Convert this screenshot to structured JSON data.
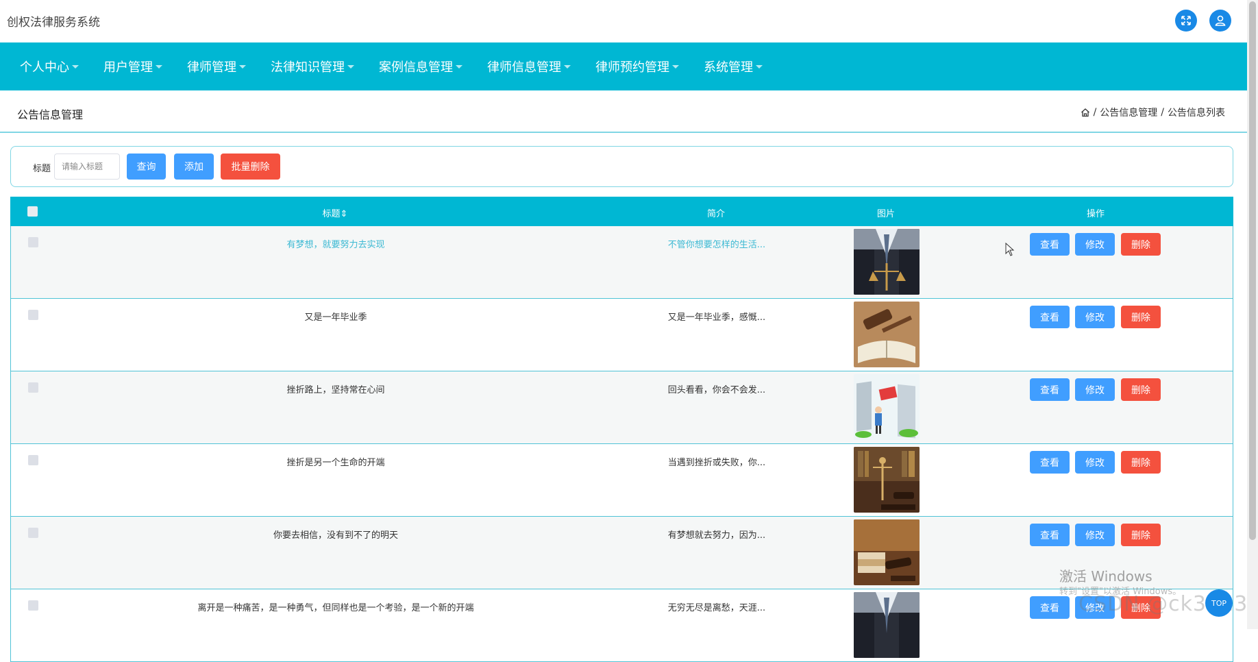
{
  "app": {
    "title": "创权法律服务系统"
  },
  "topbar": {
    "fullscreen_icon": "fullscreen-icon",
    "user_icon": "user-icon"
  },
  "nav": {
    "items": [
      {
        "label": "个人中心"
      },
      {
        "label": "用户管理"
      },
      {
        "label": "律师管理"
      },
      {
        "label": "法律知识管理"
      },
      {
        "label": "案例信息管理"
      },
      {
        "label": "律师信息管理"
      },
      {
        "label": "律师预约管理"
      },
      {
        "label": "系统管理"
      }
    ],
    "bg_color": "#00b7d3"
  },
  "page": {
    "title": "公告信息管理",
    "breadcrumb": [
      "公告信息管理",
      "公告信息列表"
    ],
    "breadcrumb_sep": "/"
  },
  "search": {
    "label": "标题",
    "placeholder": "请输入标题",
    "query_label": "查询",
    "add_label": "添加",
    "batch_delete_label": "批量删除"
  },
  "table": {
    "columns": {
      "title": "标题",
      "sort_glyph": "⇕",
      "brief": "简介",
      "image": "图片",
      "actions": "操作"
    },
    "rows": [
      {
        "title": "有梦想，就要努力去实现",
        "brief": "不管你想要怎样的生活..."
      },
      {
        "title": "又是一年毕业季",
        "brief": "又是一年毕业季，感慨..."
      },
      {
        "title": "挫折路上，坚持常在心间",
        "brief": "回头看看，你会不会发..."
      },
      {
        "title": "挫折是另一个生命的开端",
        "brief": "当遇到挫折或失败，你..."
      },
      {
        "title": "你要去相信，没有到不了的明天",
        "brief": "有梦想就去努力，因为..."
      },
      {
        "title": "离开是一种痛苦，是一种勇气，但同样也是一个考验，是一个新的开端",
        "brief": "无穷无尽是离愁，天涯..."
      }
    ],
    "view_label": "查看",
    "edit_label": "修改",
    "delete_label": "删除"
  },
  "overlay": {
    "watermark_title": "激活 Windows",
    "watermark_sub": "转到\"设置\"以激活 Windows。",
    "csdn": "CSDN @ck3013",
    "top_button": "TOP"
  },
  "colors": {
    "primary": "#409eff",
    "danger": "#f4513e",
    "accent": "#00b7d3"
  }
}
